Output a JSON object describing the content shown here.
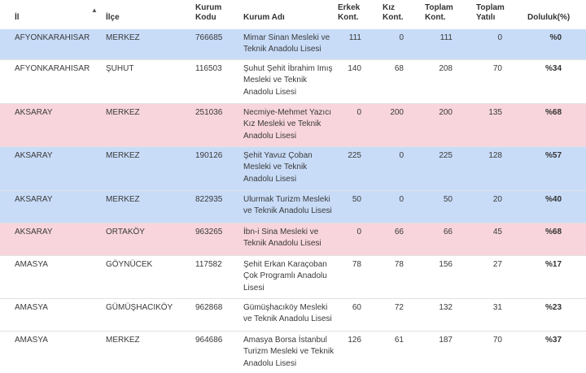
{
  "header": {
    "il": "İl",
    "ilce": "İlçe",
    "kurum_kodu": "Kurum\nKodu",
    "kurum_adi": "Kurum Adı",
    "erkek": "Erkek\nKont.",
    "kiz": "Kız\nKont.",
    "toplam": "Toplam\nKont.",
    "yatili": "Toplam\nYatılı",
    "doluluk": "Doluluk(%)"
  },
  "colors": {
    "blue_row": "#c8dcf8",
    "pink_row": "#f8d5dc",
    "white_row": "#ffffff"
  },
  "rows": [
    {
      "color": "blue",
      "il": "AFYONKARAHISAR",
      "ilce": "MERKEZ",
      "kod": "766685",
      "ad": "Mimar Sinan Mesleki ve Teknik Anadolu Lisesi",
      "erkek": "111",
      "kiz": "0",
      "toplam": "111",
      "yatili": "0",
      "doluluk": "%0"
    },
    {
      "color": "white",
      "il": "AFYONKARAHISAR",
      "ilce": "ŞUHUT",
      "kod": "116503",
      "ad": "Şuhut Şehit İbrahim Imış Mesleki ve Teknik Anadolu Lisesi",
      "erkek": "140",
      "kiz": "68",
      "toplam": "208",
      "yatili": "70",
      "doluluk": "%34"
    },
    {
      "color": "pink",
      "il": "AKSARAY",
      "ilce": "MERKEZ",
      "kod": "251036",
      "ad": "Necmiye-Mehmet Yazıcı Kız Mesleki ve Teknik Anadolu Lisesi",
      "erkek": "0",
      "kiz": "200",
      "toplam": "200",
      "yatili": "135",
      "doluluk": "%68"
    },
    {
      "color": "blue",
      "il": "AKSARAY",
      "ilce": "MERKEZ",
      "kod": "190126",
      "ad": "Şehit Yavuz Çoban Mesleki ve Teknik Anadolu Lisesi",
      "erkek": "225",
      "kiz": "0",
      "toplam": "225",
      "yatili": "128",
      "doluluk": "%57"
    },
    {
      "color": "blue",
      "il": "AKSARAY",
      "ilce": "MERKEZ",
      "kod": "822935",
      "ad": "Ulurmak Turizm Mesleki ve Teknik Anadolu Lisesi",
      "erkek": "50",
      "kiz": "0",
      "toplam": "50",
      "yatili": "20",
      "doluluk": "%40"
    },
    {
      "color": "pink",
      "il": "AKSARAY",
      "ilce": "ORTAKÖY",
      "kod": "963265",
      "ad": "İbn-i Sina Mesleki ve Teknik Anadolu Lisesi",
      "erkek": "0",
      "kiz": "66",
      "toplam": "66",
      "yatili": "45",
      "doluluk": "%68"
    },
    {
      "color": "white",
      "il": "AMASYA",
      "ilce": "GÖYNÜCEK",
      "kod": "117582",
      "ad": "Şehit Erkan Karaçoban Çok Programlı Anadolu Lisesi",
      "erkek": "78",
      "kiz": "78",
      "toplam": "156",
      "yatili": "27",
      "doluluk": "%17"
    },
    {
      "color": "white",
      "il": "AMASYA",
      "ilce": "GÜMÜŞHACIKÖY",
      "kod": "962868",
      "ad": "Gümüşhacıköy Mesleki ve Teknik Anadolu Lisesi",
      "erkek": "60",
      "kiz": "72",
      "toplam": "132",
      "yatili": "31",
      "doluluk": "%23"
    },
    {
      "color": "white",
      "il": "AMASYA",
      "ilce": "MERKEZ",
      "kod": "964686",
      "ad": "Amasya Borsa İstanbul Turizm Mesleki ve Teknik Anadolu Lisesi",
      "erkek": "126",
      "kiz": "61",
      "toplam": "187",
      "yatili": "70",
      "doluluk": "%37"
    }
  ]
}
